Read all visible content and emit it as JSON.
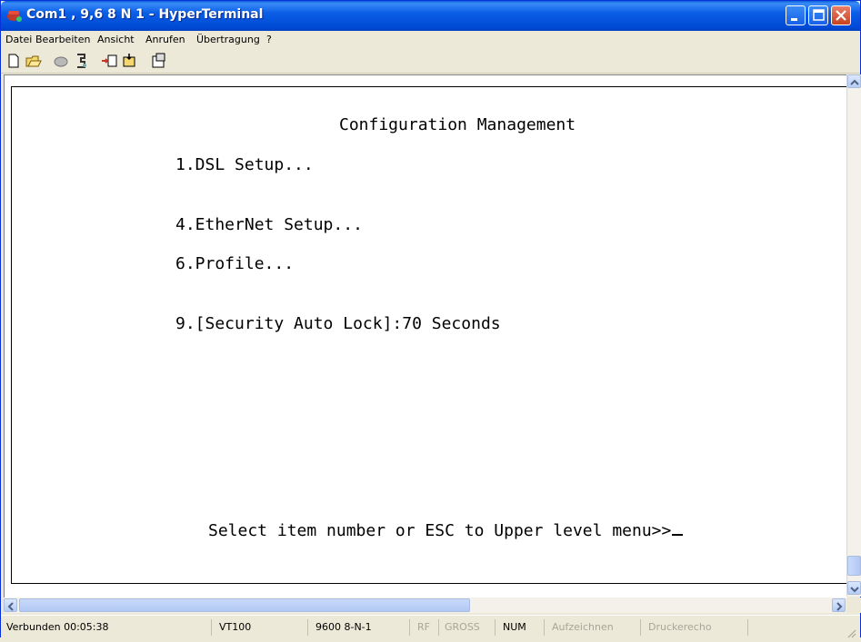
{
  "window": {
    "title": "Com1 , 9,6 8 N 1 - HyperTerminal",
    "icon": "hyperterminal-phone-icon",
    "controls": [
      "minimize-icon",
      "maximize-icon",
      "close-icon"
    ]
  },
  "menubar": {
    "items": [
      {
        "label": "Datei"
      },
      {
        "label": "Bearbeiten"
      },
      {
        "label": "Ansicht"
      },
      {
        "label": "Anrufen"
      },
      {
        "label": "Übertragung"
      },
      {
        "label": "?"
      }
    ]
  },
  "toolbar": {
    "buttons": [
      "new-icon",
      "open-icon",
      "connect-icon",
      "disconnect-icon",
      "send-icon",
      "receive-icon",
      "properties-icon"
    ]
  },
  "terminal": {
    "title": "Configuration Management",
    "items": [
      "1.DSL Setup...",
      "4.EtherNet Setup...",
      "6.Profile...",
      "9.[Security Auto Lock]:70 Seconds"
    ],
    "prompt": "Select item number or ESC to Upper level menu>>"
  },
  "statusbar": {
    "connected": "Verbunden 00:05:38",
    "emulation": "VT100",
    "port_settings": "9600 8-N-1",
    "rf": "RF",
    "gross": "GROSS",
    "num": "NUM",
    "capture": "Aufzeichnen",
    "print_echo": "Druckerecho"
  },
  "colors": {
    "titlebar": "#0b5ee6",
    "window_bg": "#ece9d8",
    "terminal_bg": "#ffffff",
    "terminal_text": "#000000"
  }
}
